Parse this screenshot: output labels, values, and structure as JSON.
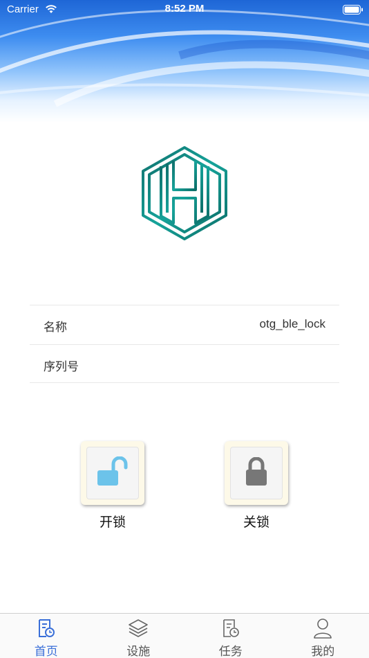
{
  "status_bar": {
    "carrier": "Carrier",
    "time": "8:52 PM"
  },
  "device_info": {
    "rows": [
      {
        "label": "名称",
        "value": "otg_ble_lock"
      },
      {
        "label": "序列号",
        "value": ""
      }
    ]
  },
  "actions": {
    "unlock_label": "开锁",
    "lock_label": "关锁"
  },
  "tab_bar": {
    "items": [
      {
        "label": "首页",
        "icon": "home-doc-icon",
        "active": true
      },
      {
        "label": "设施",
        "icon": "layers-icon",
        "active": false
      },
      {
        "label": "任务",
        "icon": "task-doc-icon",
        "active": false
      },
      {
        "label": "我的",
        "icon": "person-icon",
        "active": false
      }
    ]
  },
  "colors": {
    "accent": "#3a6fd8",
    "logo": "#0f8a82",
    "unlock_icon": "#6cc3ea",
    "lock_icon": "#777777"
  }
}
